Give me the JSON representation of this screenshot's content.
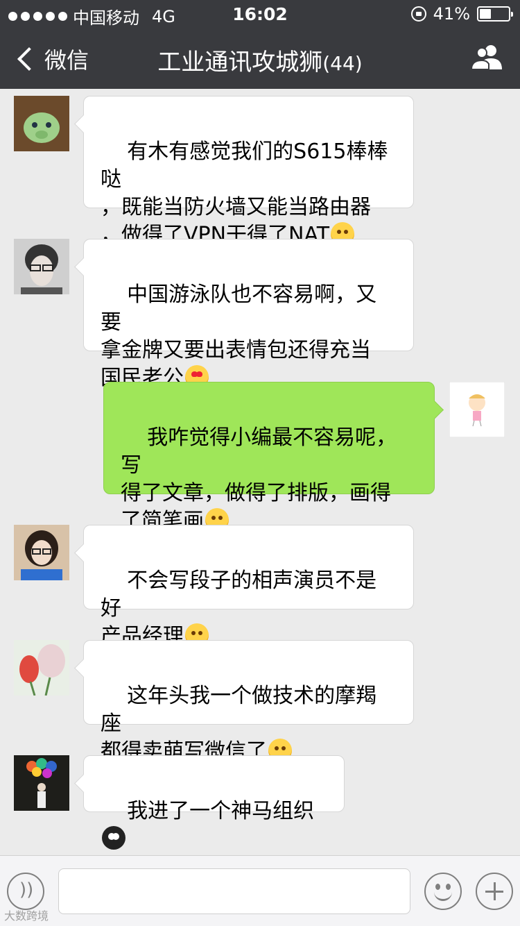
{
  "status_bar": {
    "carrier": "中国移动",
    "network": "4G",
    "time": "16:02",
    "battery": "41%",
    "battery_level": 0.41
  },
  "nav": {
    "back_label": "微信",
    "title": "工业通讯攻城狮",
    "member_count": "(44)"
  },
  "messages": [
    {
      "side": "in",
      "text": "有木有感觉我们的S615棒棒哒\n，既能当防火墙又能当路由器\n，做得了VPN干得了NAT",
      "emoji": "smile"
    },
    {
      "side": "in",
      "text": "中国游泳队也不容易啊，又要\n拿金牌又要出表情包还得充当\n国民老公",
      "emoji": "heart-eyes"
    },
    {
      "side": "out",
      "text": "我咋觉得小编最不容易呢，写\n得了文章，做得了排版，画得\n了简笔画",
      "emoji": "shy"
    },
    {
      "side": "in",
      "text": "不会写段子的相声演员不是好\n产品经理",
      "emoji": "thinking"
    },
    {
      "side": "in",
      "text": "这年头我一个做技术的摩羯座\n都得卖萌写微信了",
      "emoji": "dizzy"
    },
    {
      "side": "in",
      "text": "我进了一个神马组织",
      "emoji": "owl"
    }
  ],
  "watermark": "大数跨境",
  "colors": {
    "nav_bg": "#393a3e",
    "chat_bg": "#ebebeb",
    "outgoing_bubble": "#9fe659",
    "incoming_bubble": "#ffffff"
  }
}
